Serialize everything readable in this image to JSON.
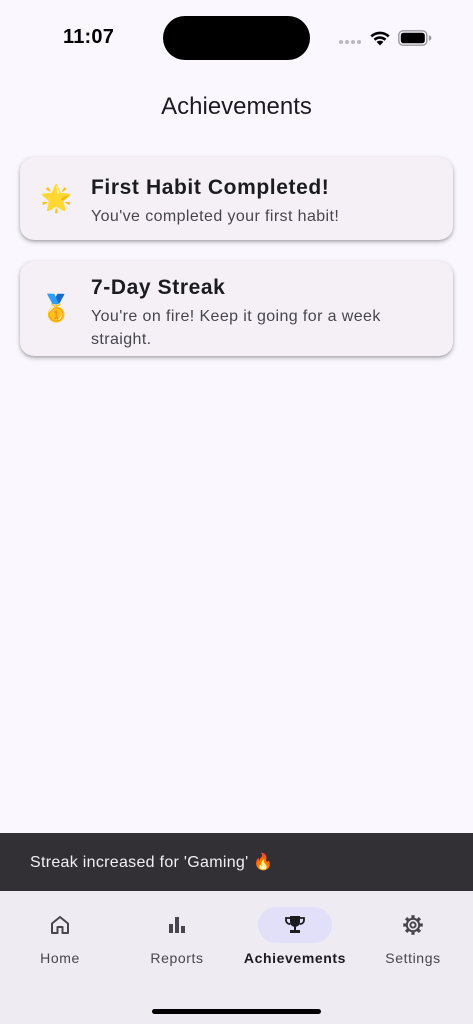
{
  "status_bar": {
    "time": "11:07"
  },
  "app_bar": {
    "title": "Achievements"
  },
  "achievements": [
    {
      "icon": "star-icon",
      "icon_glyph": "🌟",
      "title": "First Habit Completed!",
      "description": "You've completed your first habit!"
    },
    {
      "icon": "medal-icon",
      "icon_glyph": "🥇",
      "title": "7-Day Streak",
      "description": "You're on fire! Keep it going for a week straight."
    }
  ],
  "snackbar": {
    "message": "Streak increased for 'Gaming' 🔥"
  },
  "bottom_nav": {
    "selected": "Achievements",
    "items": [
      {
        "label": "Home",
        "icon": "home-icon"
      },
      {
        "label": "Reports",
        "icon": "bar-chart-icon"
      },
      {
        "label": "Achievements",
        "icon": "trophy-icon"
      },
      {
        "label": "Settings",
        "icon": "gear-icon"
      }
    ]
  },
  "colors": {
    "background": "#fbf7fe",
    "card": "#f4f0f6",
    "snackbar": "#322f35",
    "nav_background": "#efebf2",
    "nav_selected_pill": "#e2dff9",
    "text_primary": "#1c1b1f",
    "text_secondary": "#48454e"
  }
}
